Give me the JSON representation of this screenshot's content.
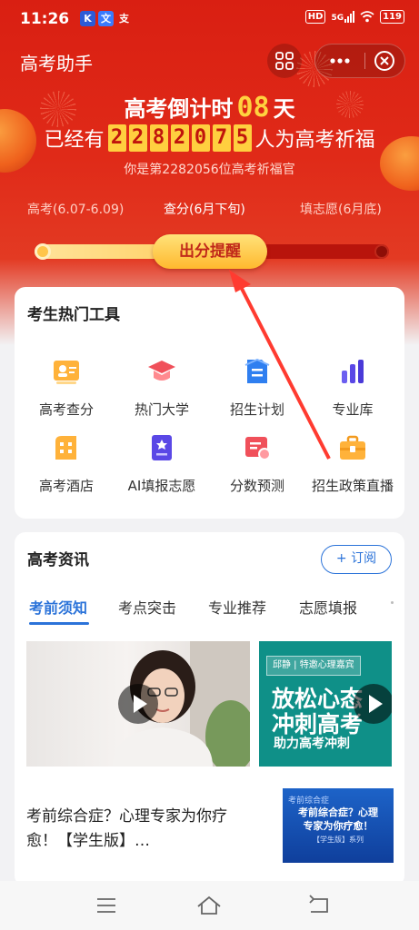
{
  "status_bar": {
    "time": "11:26",
    "app_icons": [
      "K",
      "文",
      "支"
    ],
    "hd": "HD",
    "signal": "5G",
    "battery": "119"
  },
  "header": {
    "title": "高考助手",
    "scan_icon": "scan-icon",
    "more_icon": "more-dots-icon",
    "close_icon": "close-circle-icon"
  },
  "countdown": {
    "prefix": "高考倒计时",
    "days": "08",
    "suffix": "天"
  },
  "blessing": {
    "prefix": "已经有",
    "digits": [
      "2",
      "2",
      "8",
      "2",
      "0",
      "7",
      "5"
    ],
    "suffix": "人为高考祈福",
    "rank": "你是第2282056位高考祈福官"
  },
  "phases": {
    "exam": "高考(6.07-6.09)",
    "score": "查分(6月下旬)",
    "apply": "填志愿(6月底)",
    "active": "score"
  },
  "remind_button": "出分提醒",
  "tools": {
    "title": "考生热门工具",
    "items": [
      {
        "label": "高考查分",
        "icon": "score-card-icon"
      },
      {
        "label": "热门大学",
        "icon": "graduation-cap-icon"
      },
      {
        "label": "招生计划",
        "icon": "plan-document-icon"
      },
      {
        "label": "专业库",
        "icon": "bar-chart-icon"
      },
      {
        "label": "高考酒店",
        "icon": "hotel-icon"
      },
      {
        "label": "AI填报志愿",
        "icon": "ai-form-icon"
      },
      {
        "label": "分数预测",
        "icon": "prediction-icon"
      },
      {
        "label": "招生政策直播",
        "icon": "briefcase-icon"
      }
    ]
  },
  "news": {
    "title": "高考资讯",
    "subscribe": "+ 订阅",
    "tabs": [
      "考前须知",
      "考点突击",
      "专业推荐",
      "志愿填报"
    ],
    "active_tab": 0,
    "video2": {
      "badge": "邱静 | 特邀心理嘉宾",
      "line1": "放松心态",
      "line2": "冲刺高考",
      "sub": "助力高考冲刺"
    },
    "article": {
      "title": "考前综合症？心理专家为你疗愈！【学生版】…",
      "thumb_tag": "考前综合症",
      "thumb_line1": "考前综合症？心理",
      "thumb_line2": "专家为你疗愈！",
      "thumb_small": "【学生版】系列"
    }
  },
  "nav": {
    "menu_icon": "menu-icon",
    "home_icon": "home-icon",
    "back_icon": "back-icon"
  },
  "colors": {
    "hero_red": "#d91f12",
    "gold": "#ffcf3f",
    "accent_blue": "#2b73d9"
  }
}
